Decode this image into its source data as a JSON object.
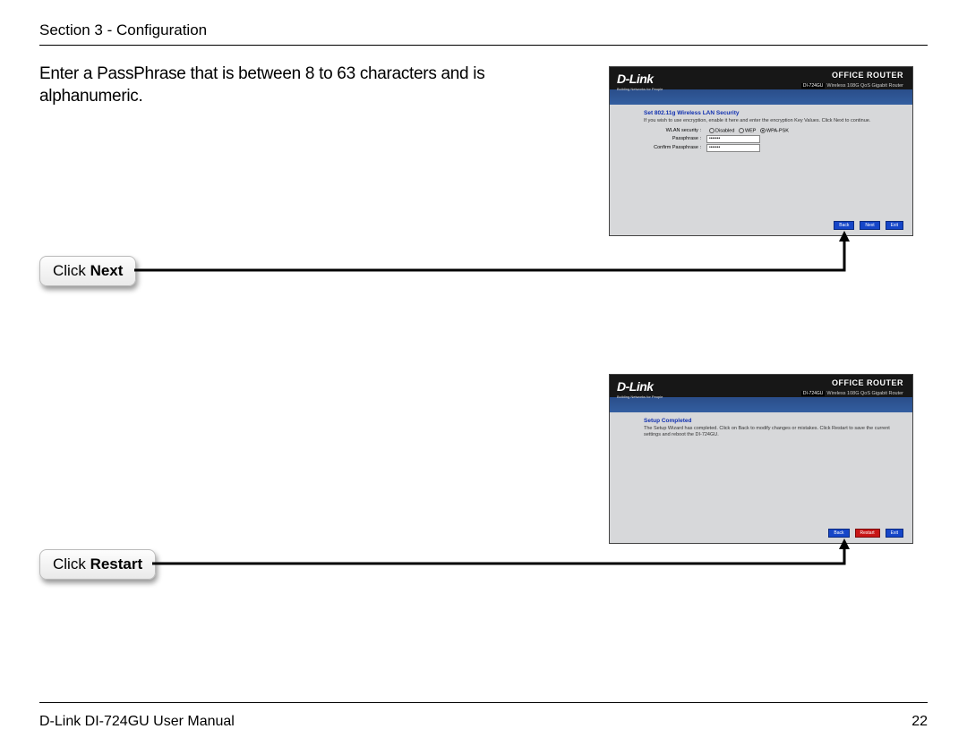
{
  "page": {
    "section_header": "Section 3 - Configuration",
    "instruction": "Enter a PassPhrase that is between 8 to 63 characters and is alphanumeric.",
    "footer_left": "D-Link DI-724GU User Manual",
    "footer_right": "22"
  },
  "callouts": {
    "c1_prefix": "Click ",
    "c1_bold": "Next",
    "c2_prefix": "Click ",
    "c2_bold": "Restart"
  },
  "router_common": {
    "logo": "D-Link",
    "tagline": "Building Networks for People",
    "office": "OFFICE ROUTER",
    "model_pill": "DI-724GU",
    "model_text": "Wireless 108G QoS Gigabit Router"
  },
  "router1": {
    "sec_title": "Set 802.11g Wireless LAN Security",
    "text": "If you wish to use encryption, enable it here and enter the encryption Key Values. Click Next to continue.",
    "wlan_label": "WLAN security :",
    "opt_disabled": "Disabled",
    "opt_wep": "WEP",
    "opt_wpa": "WPA-PSK",
    "pass_label": "Passphrase :",
    "confirm_label": "Confirm Passphrase :",
    "pass_value": "•••••••",
    "confirm_value": "•••••••",
    "btn_back": "Back",
    "btn_next": "Next",
    "btn_exit": "Exit"
  },
  "router2": {
    "sec_title": "Setup Completed",
    "text": "The Setup Wizard has completed. Click on Back to modify changes or mistakes. Click Restart to save the current settings and reboot the DI-724GU.",
    "btn_back": "Back",
    "btn_restart": "Restart",
    "btn_exit": "Exit"
  }
}
